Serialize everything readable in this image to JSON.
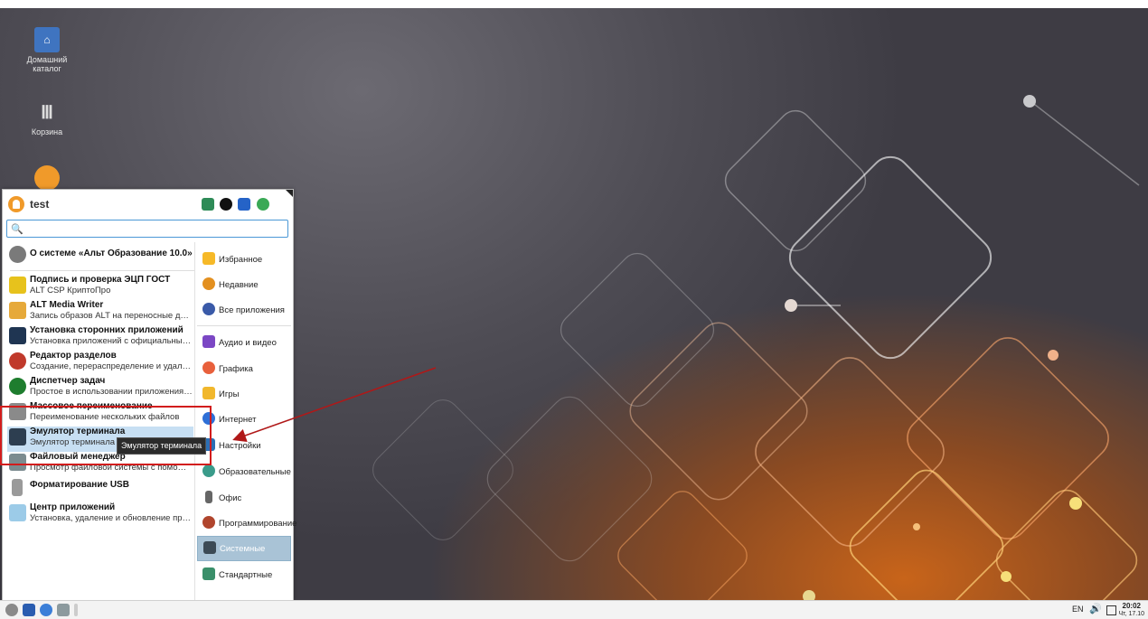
{
  "desktop": {
    "icons": [
      {
        "label": "Домашний каталог",
        "icon": "home-folder-icon"
      },
      {
        "label": "Корзина",
        "icon": "trash-icon"
      },
      {
        "label": "",
        "icon": "alt-logo-icon"
      }
    ]
  },
  "menu": {
    "user": "test",
    "search": {
      "value": "",
      "placeholder": ""
    },
    "apps": [
      {
        "title": "О системе «Альт Образование 10.0»",
        "subtitle": "",
        "icon": "alt-about-icon"
      },
      {
        "title": "Подпись и проверка ЭЦП ГОСТ",
        "subtitle": "ALT CSP КриптоПро",
        "icon": "signature-icon"
      },
      {
        "title": "ALT Media Writer",
        "subtitle": "Запись образов ALT на переносные диски",
        "icon": "media-writer-icon"
      },
      {
        "title": "Установка сторонних приложений",
        "subtitle": "Установка приложений с официальных с...",
        "icon": "third-party-apps-icon"
      },
      {
        "title": "Редактор разделов",
        "subtitle": "Создание, перераспределение и удалени...",
        "icon": "partition-editor-icon"
      },
      {
        "title": "Диспетчер задач",
        "subtitle": "Простое в использовании приложения дл...",
        "icon": "task-manager-icon"
      },
      {
        "title": "Массовое переименование",
        "subtitle": "Переименование нескольких файлов",
        "icon": "bulk-rename-icon"
      },
      {
        "title": "Эмулятор терминала",
        "subtitle": "Эмулятор терминала",
        "icon": "terminal-icon"
      },
      {
        "title": "Файловый менеджер",
        "subtitle": "Просмотр файловой системы с помощью...",
        "icon": "file-manager-icon"
      },
      {
        "title": "Форматирование USB",
        "subtitle": "",
        "icon": "usb-format-icon"
      },
      {
        "title": "Центр приложений",
        "subtitle": "Установка, удаление и обновление прогр...",
        "icon": "app-center-icon"
      }
    ],
    "categories": [
      {
        "label": "Избранное",
        "icon": "star-icon",
        "color": "#f6b928"
      },
      {
        "label": "Недавние",
        "icon": "clock-icon",
        "color": "#e39020"
      },
      {
        "label": "Все приложения",
        "icon": "all-apps-icon",
        "color": "#3a5aa8"
      },
      {
        "label": "Аудио и видео",
        "icon": "audio-video-icon",
        "color": "#7b47c4"
      },
      {
        "label": "Графика",
        "icon": "graphics-icon",
        "color": "#e8603c"
      },
      {
        "label": "Игры",
        "icon": "games-icon",
        "color": "#f1b72c"
      },
      {
        "label": "Интернет",
        "icon": "internet-icon",
        "color": "#2f6fd6"
      },
      {
        "label": "Настройки",
        "icon": "settings-icon",
        "color": "#2c6fb4"
      },
      {
        "label": "Образовательные",
        "icon": "education-icon",
        "color": "#3a9b8a"
      },
      {
        "label": "Офис",
        "icon": "office-icon",
        "color": "#666666"
      },
      {
        "label": "Программирование",
        "icon": "programming-icon",
        "color": "#b0452d"
      },
      {
        "label": "Системные",
        "icon": "system-icon",
        "color": "#3c4a55"
      },
      {
        "label": "Стандартные",
        "icon": "accessories-icon",
        "color": "#3a8f6a"
      }
    ],
    "tooltip": "Эмулятор терминала"
  },
  "taskbar": {
    "lang": "EN",
    "time": "20:02",
    "date": "Чт, 17.10"
  },
  "colors": {
    "accent": "#4b98d6",
    "annotation": "#d21c1c"
  }
}
